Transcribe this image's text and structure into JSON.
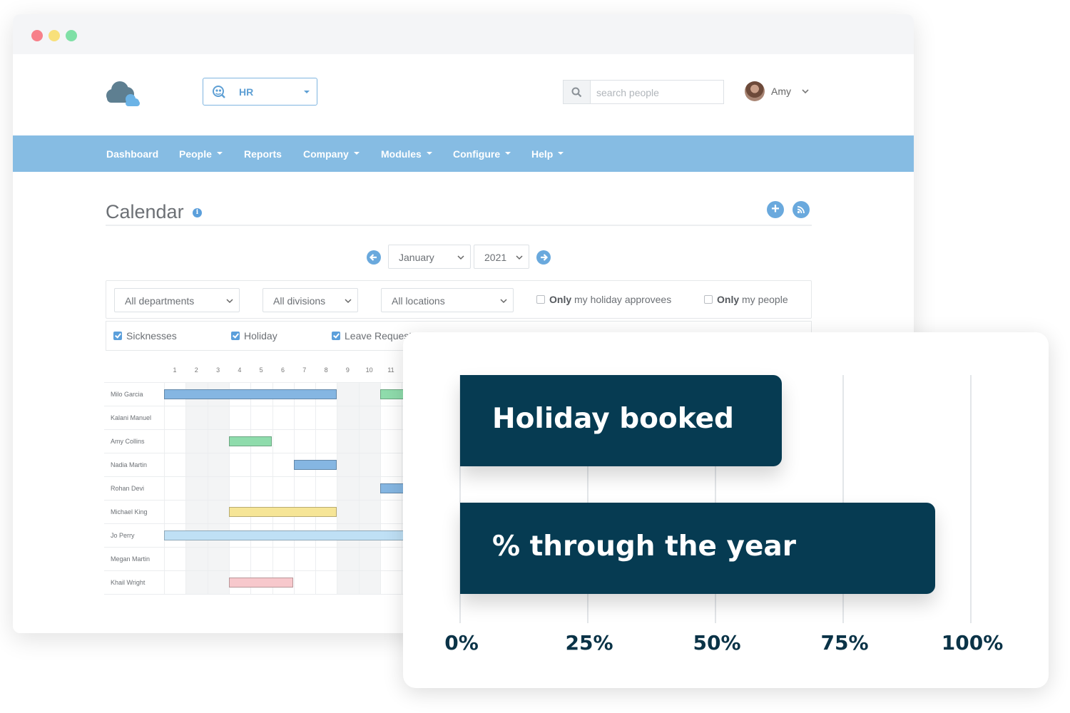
{
  "header": {
    "module_label": "HR",
    "search_placeholder": "search people",
    "user_name": "Amy"
  },
  "nav": {
    "items": [
      {
        "label": "Dashboard",
        "dropdown": false
      },
      {
        "label": "People",
        "dropdown": true
      },
      {
        "label": "Reports",
        "dropdown": false
      },
      {
        "label": "Company",
        "dropdown": true
      },
      {
        "label": "Modules",
        "dropdown": true
      },
      {
        "label": "Configure",
        "dropdown": true
      },
      {
        "label": "Help",
        "dropdown": true
      }
    ]
  },
  "page": {
    "title": "Calendar",
    "info": "i",
    "add": "+"
  },
  "month_nav": {
    "month": "January",
    "year": "2021"
  },
  "filters": {
    "departments": "All departments",
    "divisions": "All divisions",
    "locations": "All locations",
    "approvees_strong": "Only",
    "approvees_rest": " my holiday approvees",
    "people_strong": "Only",
    "people_rest": " my people"
  },
  "types": [
    {
      "label": "Sicknesses",
      "checked": true
    },
    {
      "label": "Holiday",
      "checked": true
    },
    {
      "label": "Leave Request",
      "checked": true
    }
  ],
  "calendar": {
    "days": [
      "1",
      "2",
      "3",
      "4",
      "5",
      "6",
      "7",
      "8",
      "9",
      "10",
      "11"
    ],
    "rows": [
      {
        "name": "Milo Garcia",
        "bars": [
          {
            "start": 1,
            "end": 8,
            "color": "#85b6e2"
          },
          {
            "start": 11,
            "end": 11.99,
            "color": "#8fdcac"
          }
        ]
      },
      {
        "name": "Kalani Manuel",
        "bars": []
      },
      {
        "name": "Amy Collins",
        "bars": [
          {
            "start": 4,
            "end": 4.99,
            "color": "#8fdcac"
          }
        ]
      },
      {
        "name": "Nadia Martin",
        "bars": [
          {
            "start": 7,
            "end": 8,
            "color": "#85b6e2"
          }
        ]
      },
      {
        "name": "Rohan Devi",
        "bars": [
          {
            "start": 11,
            "end": 11.99,
            "color": "#85b6e2"
          }
        ]
      },
      {
        "name": "Michael King",
        "bars": [
          {
            "start": 4,
            "end": 8,
            "color": "#f6e597"
          }
        ]
      },
      {
        "name": "Jo Perry",
        "bars": [
          {
            "start": 1,
            "end": 11.99,
            "color": "#bfe0f5"
          }
        ]
      },
      {
        "name": "Megan Martin",
        "bars": []
      },
      {
        "name": "Khail Wright",
        "bars": [
          {
            "start": 4,
            "end": 5.99,
            "color": "#f7c8cc"
          }
        ]
      }
    ],
    "weekend_days": [
      2,
      3,
      9,
      10
    ]
  },
  "chart_data": {
    "type": "bar",
    "orientation": "horizontal",
    "categories": [
      "Holiday booked",
      "% through the year"
    ],
    "values": [
      63,
      93
    ],
    "unit": "%",
    "xlim": [
      0,
      100
    ],
    "ticks": [
      "0%",
      "25%",
      "50%",
      "75%",
      "100%"
    ],
    "tick_values": [
      0,
      25,
      50,
      75,
      100
    ],
    "bar_color": "#063b52",
    "grid": true
  }
}
